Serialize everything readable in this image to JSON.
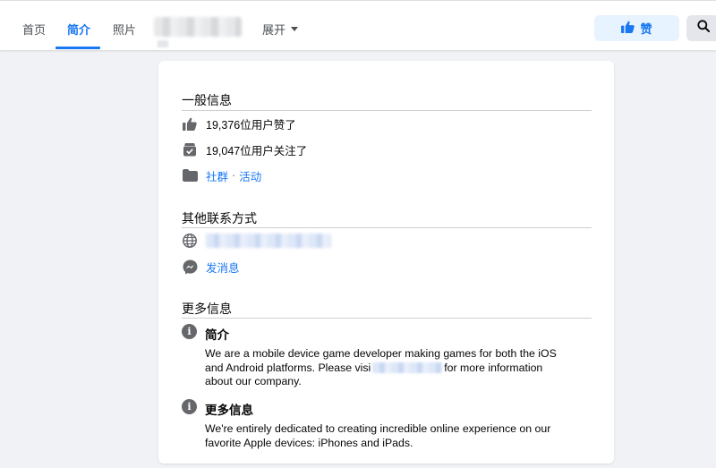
{
  "nav": {
    "tabs": [
      {
        "label": "首页",
        "active": false
      },
      {
        "label": "简介",
        "active": true
      },
      {
        "label": "照片",
        "active": false
      }
    ],
    "expand_label": "展开",
    "like_label": "赞"
  },
  "general": {
    "title": "一般信息",
    "likes_text": "19,376位用户赞了",
    "follows_text": "19,047位用户关注了",
    "category_1": "社群",
    "separator": "·",
    "category_2": "活动"
  },
  "contact": {
    "title": "其他联系方式",
    "message_label": "发消息"
  },
  "more": {
    "title": "更多信息",
    "about_title": "简介",
    "about_text_1": "We are a mobile device game developer making games for both the iOS",
    "about_text_2a": "and Android platforms. Please visi",
    "about_text_2b": "for more information",
    "about_text_3": "about our company.",
    "more_title": "更多信息",
    "more_text_1": "We're entirely dedicated to creating incredible online experience on our",
    "more_text_2": "favorite Apple devices: iPhones and iPads."
  },
  "colors": {
    "accent": "#1877f2",
    "icon_gray": "#65676b",
    "background": "#f0f2f5"
  },
  "icons": [
    "thumbs-up-icon",
    "follow-check-icon",
    "category-icon",
    "globe-icon",
    "messenger-icon",
    "info-icon",
    "search-icon",
    "caret-down-icon"
  ]
}
